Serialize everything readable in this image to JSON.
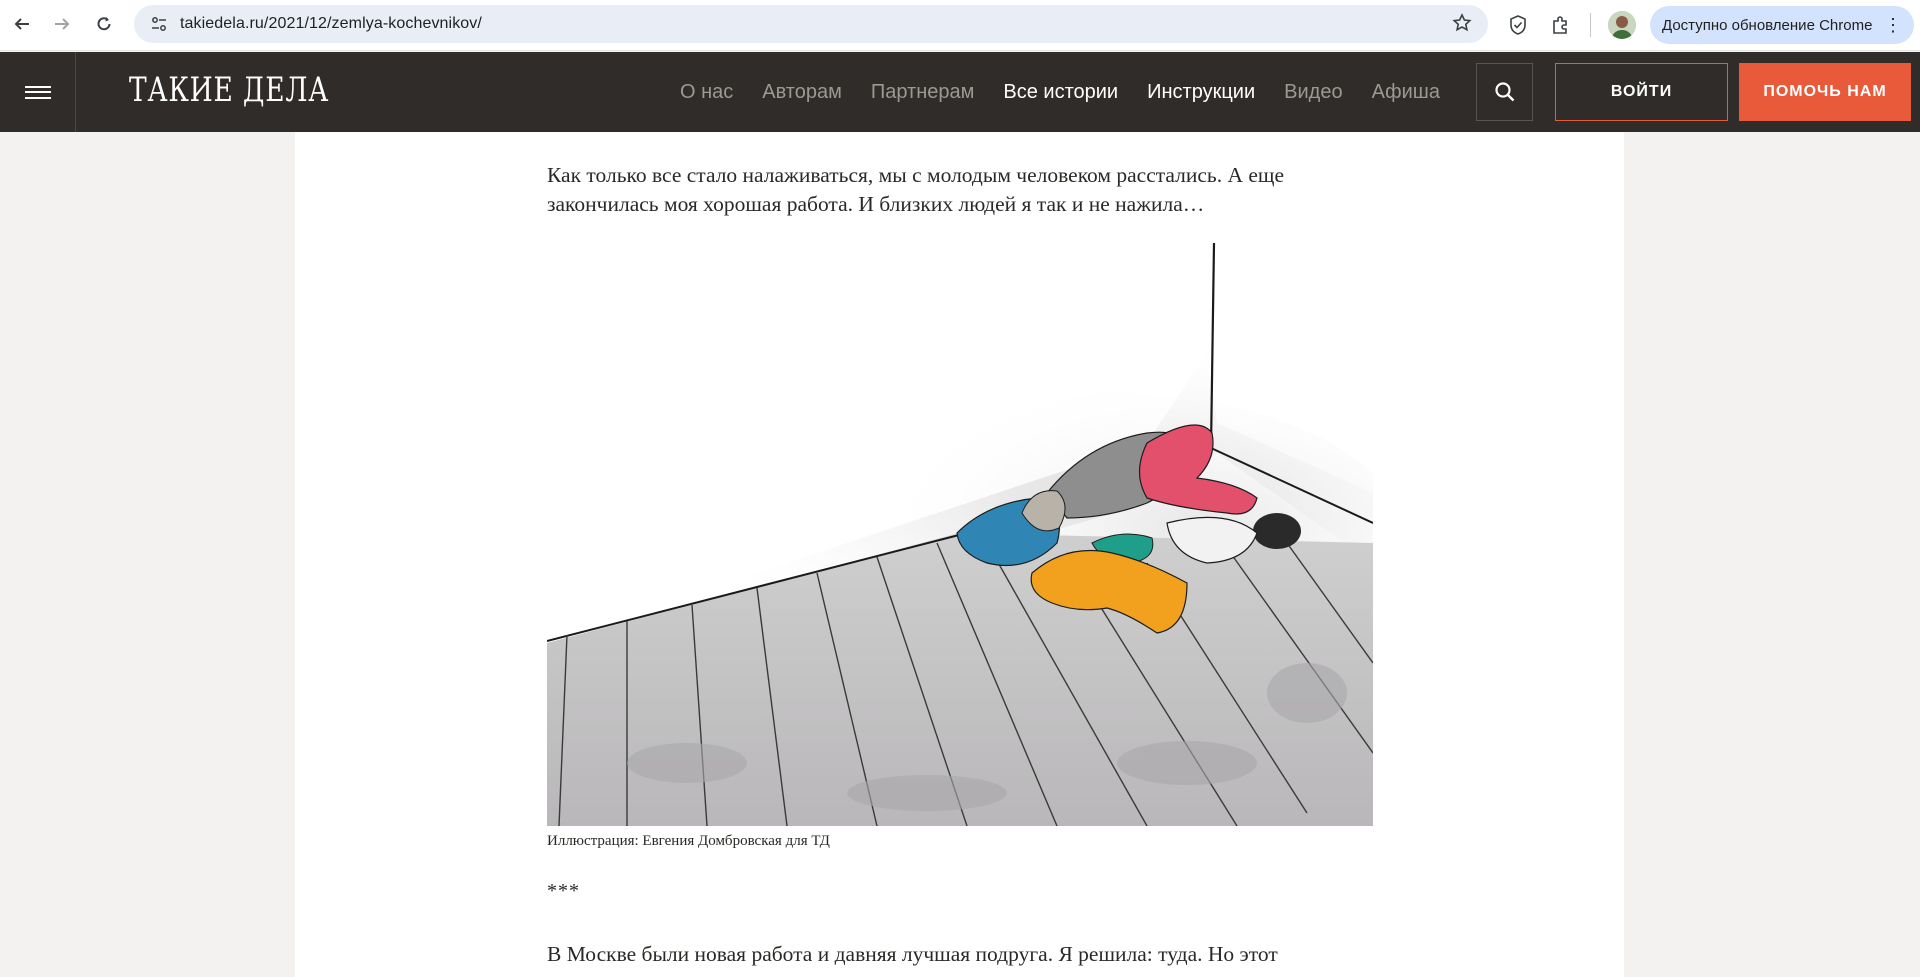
{
  "browser": {
    "url": "takiedela.ru/2021/12/zemlya-kochevnikov/",
    "update_label": "Доступно обновление Chrome"
  },
  "header": {
    "logo": "ТАКИЕ ДЕЛА",
    "nav": [
      {
        "label": "О нас",
        "active": false
      },
      {
        "label": "Авторам",
        "active": false
      },
      {
        "label": "Партнерам",
        "active": false
      },
      {
        "label": "Все истории",
        "active": true
      },
      {
        "label": "Инструкции",
        "active": true
      },
      {
        "label": "Видео",
        "active": false
      },
      {
        "label": "Афиша",
        "active": false
      }
    ],
    "login_label": "ВОЙТИ",
    "help_label": "ПОМОЧЬ НАМ"
  },
  "article": {
    "paragraph_1": "Как только все стало налаживаться, мы с молодым человеком расстались. А еще закончилась моя хорошая работа. И близких людей я так и не нажила…",
    "image_caption": "Иллюстрация: Евгения Домбровская для ТД",
    "separator": "***",
    "paragraph_2": "В Москве были новая работа и давняя лучшая подруга. Я решила: туда. Но этот"
  },
  "colors": {
    "header_bg": "#2f2c29",
    "accent": "#e85a3a",
    "page_bg": "#f3f2f0"
  }
}
